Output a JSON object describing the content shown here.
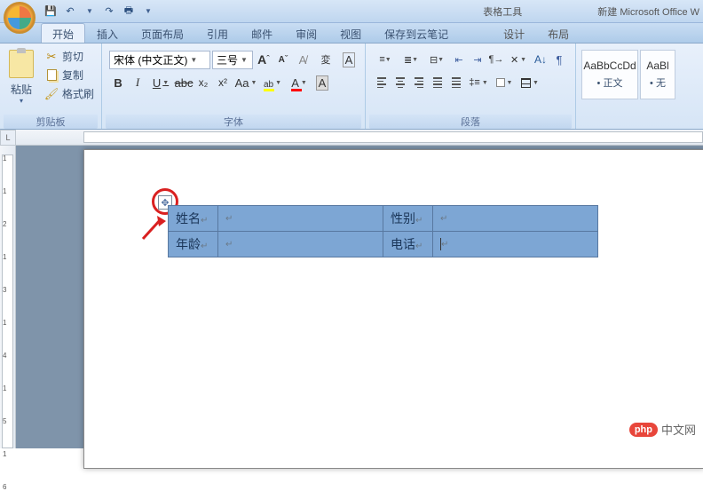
{
  "title_bar": {
    "table_tools": "表格工具",
    "doc_title": "新建 Microsoft Office W"
  },
  "qat": {
    "save": "💾",
    "undo": "↶",
    "redo": "↷",
    "print": "🖶"
  },
  "tabs": {
    "home": "开始",
    "insert": "插入",
    "layout": "页面布局",
    "references": "引用",
    "mailings": "邮件",
    "review": "审阅",
    "view": "视图",
    "cloud": "保存到云笔记",
    "design": "设计",
    "tbl_layout": "布局"
  },
  "ribbon": {
    "clipboard": {
      "label": "剪贴板",
      "paste": "粘贴",
      "cut": "剪切",
      "copy": "复制",
      "format_painter": "格式刷"
    },
    "font": {
      "label": "字体",
      "name": "宋体 (中文正文)",
      "size": "三号",
      "grow": "A",
      "shrink": "A",
      "clear": "Aa",
      "pinyin": "拼",
      "bold": "B",
      "italic": "I",
      "underline": "U",
      "strike": "abc",
      "sub": "x₂",
      "sup": "x²",
      "case": "Aa",
      "highlight": "ab",
      "color": "A",
      "shade": "A",
      "border": "A"
    },
    "paragraph": {
      "label": "段落"
    },
    "styles": {
      "normal_preview": "AaBbCcDd",
      "normal_name": "• 正文",
      "nospacing_preview": "AaBl",
      "nospacing_name": "• 无"
    }
  },
  "ruler": {
    "corner": "L",
    "v": [
      "1",
      "1",
      "2",
      "1",
      "3",
      "1",
      "4",
      "1",
      "5",
      "1",
      "6"
    ]
  },
  "table": {
    "r1c1": "姓名",
    "r1c2": "",
    "r1c3": "性别",
    "r1c4": "",
    "r2c1": "年龄",
    "r2c2": "",
    "r2c3": "电话",
    "r2c4": ""
  },
  "watermark": {
    "badge": "php",
    "text": "中文网"
  }
}
